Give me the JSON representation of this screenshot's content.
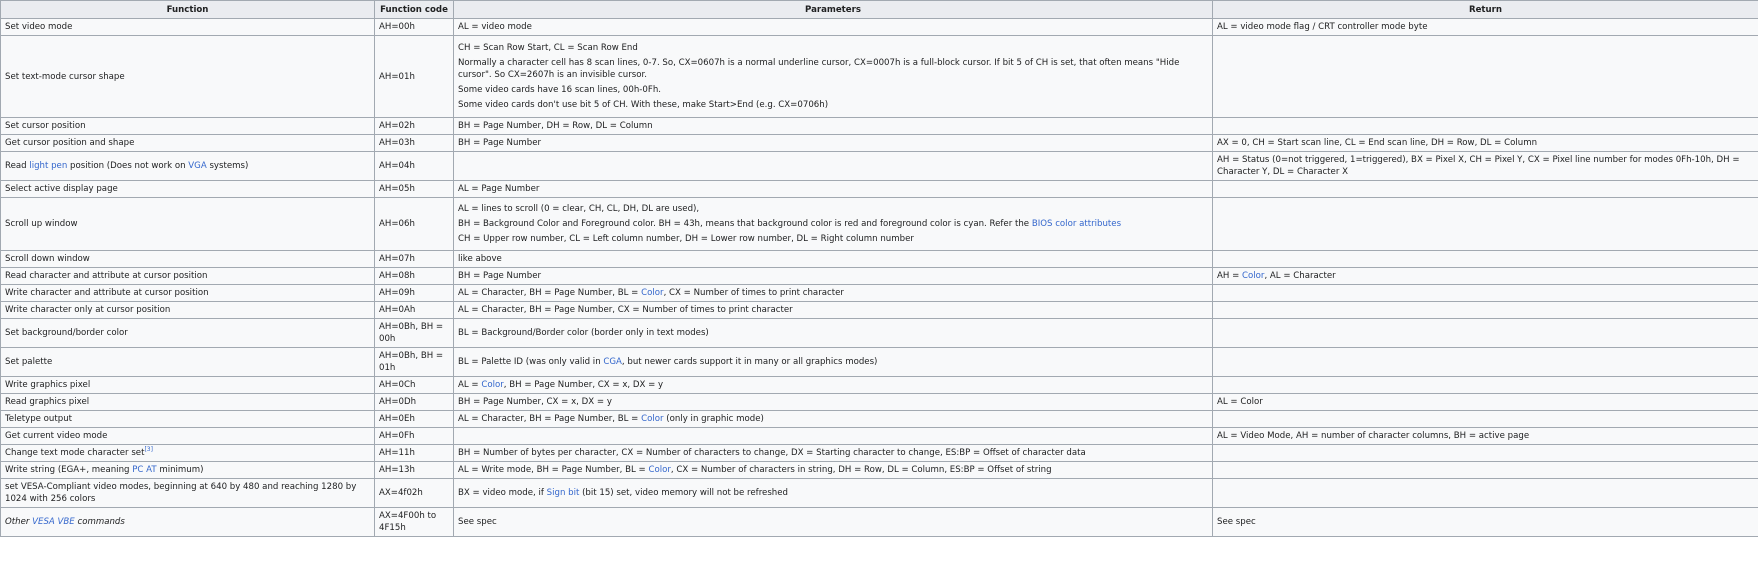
{
  "headers": [
    "Function",
    "Function code",
    "Parameters",
    "Return"
  ],
  "rows": [
    {
      "fn": [
        "Set video mode"
      ],
      "code": "AH=00h",
      "params": [
        [
          "AL = video mode"
        ]
      ],
      "ret": [
        "AL = video mode flag / CRT controller mode byte"
      ]
    },
    {
      "fn": [
        "Set text-mode cursor shape"
      ],
      "code": "AH=01h",
      "params": [
        [
          "CH = Scan Row Start, CL = Scan Row End"
        ],
        [
          "Normally a character cell has 8 scan lines, 0-7. So, CX=0607h is a normal underline cursor, CX=0007h is a full-block cursor. If bit 5 of CH is set, that often means \"Hide cursor\". So CX=2607h is an invisible cursor."
        ],
        [
          "Some video cards have 16 scan lines, 00h-0Fh."
        ],
        [
          "Some video cards don't use bit 5 of CH. With these, make Start>End (e.g. CX=0706h)"
        ]
      ],
      "ret": [
        ""
      ]
    },
    {
      "fn": [
        "Set cursor position"
      ],
      "code": "AH=02h",
      "params": [
        [
          "BH = Page Number, DH = Row, DL = Column"
        ]
      ],
      "ret": [
        ""
      ]
    },
    {
      "fn": [
        "Get cursor position and shape"
      ],
      "code": "AH=03h",
      "params": [
        [
          "BH = Page Number"
        ]
      ],
      "ret": [
        "AX = 0, CH = Start scan line, CL = End scan line, DH = Row, DL = Column"
      ]
    },
    {
      "fn": [
        "Read ",
        {
          "link": "light pen"
        },
        " position (Does not work on ",
        {
          "link": "VGA"
        },
        " systems)"
      ],
      "code": "AH=04h",
      "params": [
        [
          ""
        ]
      ],
      "ret": [
        "AH = Status (0=not triggered, 1=triggered), BX = Pixel X, CH = Pixel Y, CX = Pixel line number for modes 0Fh-10h, DH = Character Y, DL = Character X"
      ]
    },
    {
      "fn": [
        "Select active display page"
      ],
      "code": "AH=05h",
      "params": [
        [
          "AL = Page Number"
        ]
      ],
      "ret": [
        ""
      ]
    },
    {
      "fn": [
        "Scroll up window"
      ],
      "code": "AH=06h",
      "params": [
        [
          "AL = lines to scroll (0 = clear, CH, CL, DH, DL are used),"
        ],
        [
          "BH = Background Color and Foreground color. BH = 43h, means that background color is red and foreground color is cyan. Refer the ",
          {
            "link": "BIOS color attributes"
          }
        ],
        [
          "CH = Upper row number, CL = Left column number, DH = Lower row number, DL = Right column number"
        ]
      ],
      "ret": [
        ""
      ]
    },
    {
      "fn": [
        "Scroll down window"
      ],
      "code": "AH=07h",
      "params": [
        [
          "like above"
        ]
      ],
      "ret": [
        ""
      ]
    },
    {
      "fn": [
        "Read character and attribute at cursor position"
      ],
      "code": "AH=08h",
      "params": [
        [
          "BH = Page Number"
        ]
      ],
      "ret": [
        "AH = ",
        {
          "link": "Color"
        },
        ", AL = Character"
      ]
    },
    {
      "fn": [
        "Write character and attribute at cursor position"
      ],
      "code": "AH=09h",
      "params": [
        [
          "AL = Character, BH = Page Number, BL = ",
          {
            "link": "Color"
          },
          ", CX = Number of times to print character"
        ]
      ],
      "ret": [
        ""
      ]
    },
    {
      "fn": [
        "Write character only at cursor position"
      ],
      "code": "AH=0Ah",
      "params": [
        [
          "AL = Character, BH = Page Number, CX = Number of times to print character"
        ]
      ],
      "ret": [
        ""
      ]
    },
    {
      "fn": [
        "Set background/border color"
      ],
      "code": "AH=0Bh, BH = 00h",
      "params": [
        [
          "BL = Background/Border color (border only in text modes)"
        ]
      ],
      "ret": [
        ""
      ]
    },
    {
      "fn": [
        "Set palette"
      ],
      "code": "AH=0Bh, BH = 01h",
      "params": [
        [
          "BL = Palette ID (was only valid in ",
          {
            "link": "CGA"
          },
          ", but newer cards support it in many or all graphics modes)"
        ]
      ],
      "ret": [
        ""
      ]
    },
    {
      "fn": [
        "Write graphics pixel"
      ],
      "code": "AH=0Ch",
      "params": [
        [
          "AL = ",
          {
            "link": "Color"
          },
          ", BH = Page Number, CX = x, DX = y"
        ]
      ],
      "ret": [
        ""
      ]
    },
    {
      "fn": [
        "Read graphics pixel"
      ],
      "code": "AH=0Dh",
      "params": [
        [
          "BH = Page Number, CX = x, DX = y"
        ]
      ],
      "ret": [
        "AL = Color"
      ]
    },
    {
      "fn": [
        "Teletype output"
      ],
      "code": "AH=0Eh",
      "params": [
        [
          "AL = Character, BH = Page Number, BL = ",
          {
            "link": "Color"
          },
          " (only in graphic mode)"
        ]
      ],
      "ret": [
        ""
      ]
    },
    {
      "fn": [
        "Get current video mode"
      ],
      "code": "AH=0Fh",
      "params": [
        [
          ""
        ]
      ],
      "ret": [
        "AL = Video Mode, AH = number of character columns, BH = active page"
      ]
    },
    {
      "fn": [
        "Change text mode character set",
        {
          "sup": "[3]"
        }
      ],
      "code": "AH=11h",
      "params": [
        [
          "BH = Number of bytes per character, CX = Number of characters to change, DX = Starting character to change, ES:BP = Offset of character data"
        ]
      ],
      "ret": [
        ""
      ]
    },
    {
      "fn": [
        "Write string (EGA+, meaning ",
        {
          "link": "PC AT"
        },
        " minimum)"
      ],
      "code": "AH=13h",
      "params": [
        [
          "AL = Write mode, BH = Page Number, BL = ",
          {
            "link": "Color"
          },
          ", CX = Number of characters in string, DH = Row, DL = Column, ES:BP = Offset of string"
        ]
      ],
      "ret": [
        ""
      ]
    },
    {
      "fn": [
        "set VESA-Compliant video modes, beginning at 640 by 480 and reaching 1280 by 1024 with 256 colors"
      ],
      "code": "AX=4f02h",
      "params": [
        [
          "BX = video mode, if ",
          {
            "link": "Sign bit"
          },
          " (bit 15) set, video memory will not be refreshed"
        ]
      ],
      "ret": [
        ""
      ]
    },
    {
      "fn": [
        {
          "italic": "Other "
        },
        {
          "link_italic": "VESA"
        },
        {
          "italic": " "
        },
        {
          "link_italic": "VBE"
        },
        {
          "italic": " commands"
        }
      ],
      "code": "AX=4F00h to 4F15h",
      "params": [
        [
          "See spec"
        ]
      ],
      "ret": [
        "See spec"
      ]
    }
  ]
}
